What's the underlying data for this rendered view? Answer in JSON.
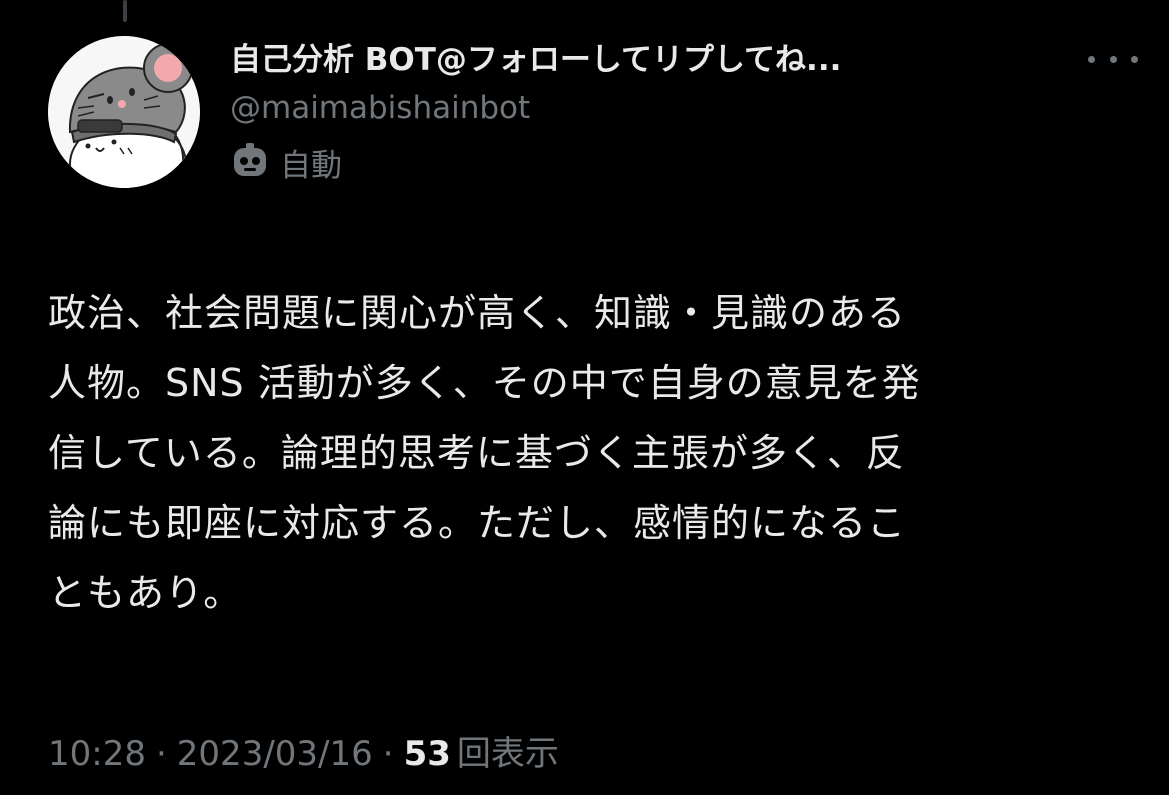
{
  "colors": {
    "background": "#000000",
    "primary_text": "#e7e9ea",
    "secondary_text": "#71767b"
  },
  "author": {
    "display_name": "自己分析 BOT@フォローしてリプしてね...",
    "handle": "@maimabishainbot",
    "automated_label": "自動",
    "avatar_icon": "mouse-hat-avatar-icon",
    "automated_icon": "bot-icon"
  },
  "menu": {
    "more_icon": "more-icon"
  },
  "tweet": {
    "lines": [
      "政治、社会問題に関心が高く、知識・見識のある",
      "人物。SNS 活動が多く、その中で自身の意見を発",
      "信している。論理的思考に基づく主張が多く、反",
      "論にも即座に対応する。ただし、感情的になるこ",
      "ともあり。"
    ]
  },
  "meta": {
    "time": "10:28",
    "separator": "·",
    "date": "2023/03/16",
    "views_count": "53",
    "views_label": "回表示"
  }
}
